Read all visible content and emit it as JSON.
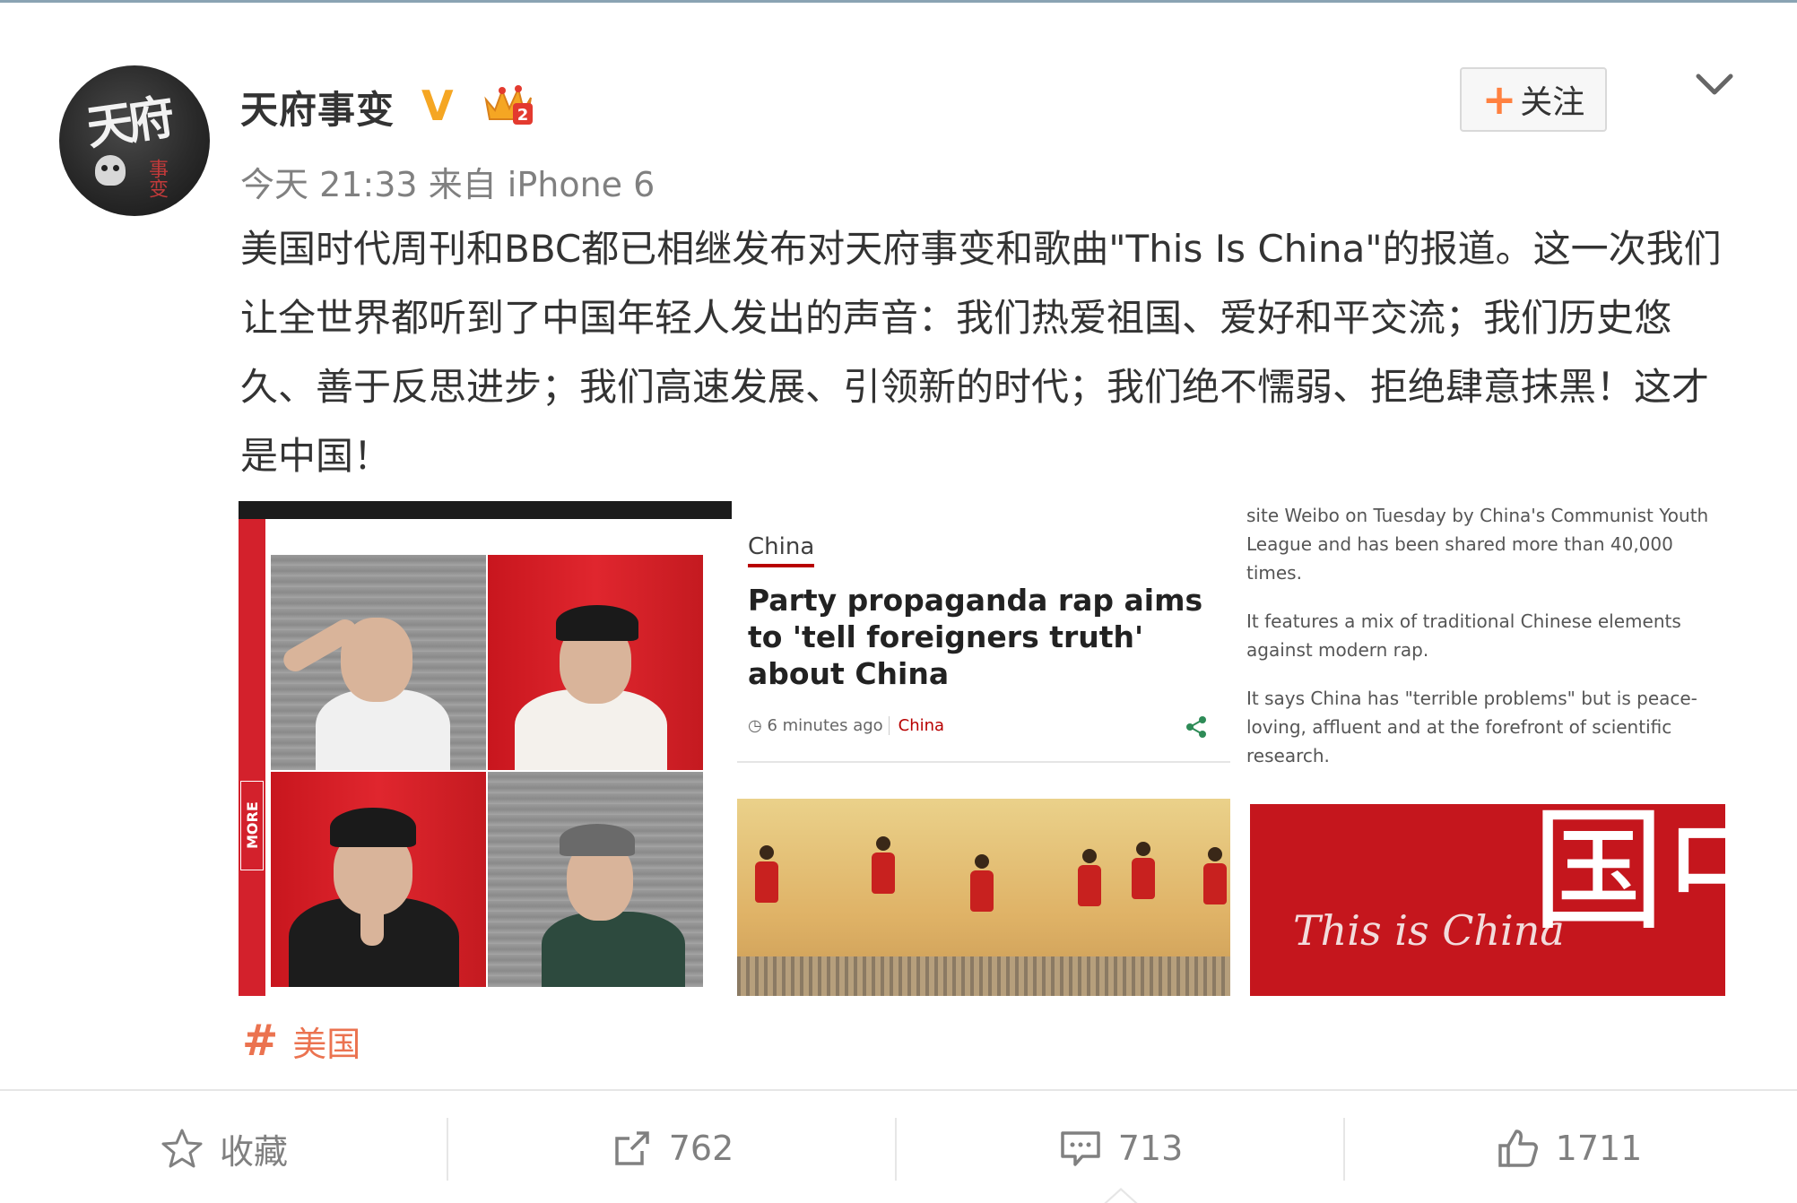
{
  "post": {
    "username": "天府事变",
    "verified_badge": "V",
    "timestamp": "今天 21:33",
    "source": "来自 iPhone 6",
    "text": "美国时代周刊和BBC都已相继发布对天府事变和歌曲\"This Is China\"的报道。这一次我们让全世界都听到了中国年轻人发出的声音：我们热爱祖国、爱好和平交流；我们历史悠久、善于反思进步；我们高速发展、引领新的时代；我们绝不懦弱、拒绝肆意抹黑！这才是中国！",
    "topic": "美国"
  },
  "header": {
    "follow_label": "关注",
    "follow_icon": "plus-icon",
    "menu_icon": "chevron-down-icon"
  },
  "images": {
    "image1": {
      "side_tab": "MORE"
    },
    "image2": {
      "tag": "China",
      "headline": "Party propaganda rap aims to 'tell foreigners truth' about China",
      "time": "6 minutes ago",
      "category": "China"
    },
    "image3": {
      "para1": "site Weibo on Tuesday by China's Communist Youth League and has been shared more than 40,000 times.",
      "para2": "It features a mix of traditional Chinese elements against modern rap.",
      "para3": "It says China has \"terrible problems\" but is peace-loving, affluent and at the forefront of scientific research.",
      "banner_script": "This is China",
      "banner_chinese": "中国"
    }
  },
  "actions": {
    "favorite_label": "收藏",
    "repost_count": "762",
    "comment_count": "713",
    "like_count": "1711"
  },
  "colors": {
    "accent_orange": "#ff8140",
    "topic_orange": "#eb7350",
    "badge_gold": "#f5a623",
    "bbc_red": "#b80000",
    "muted_text": "#808080"
  }
}
